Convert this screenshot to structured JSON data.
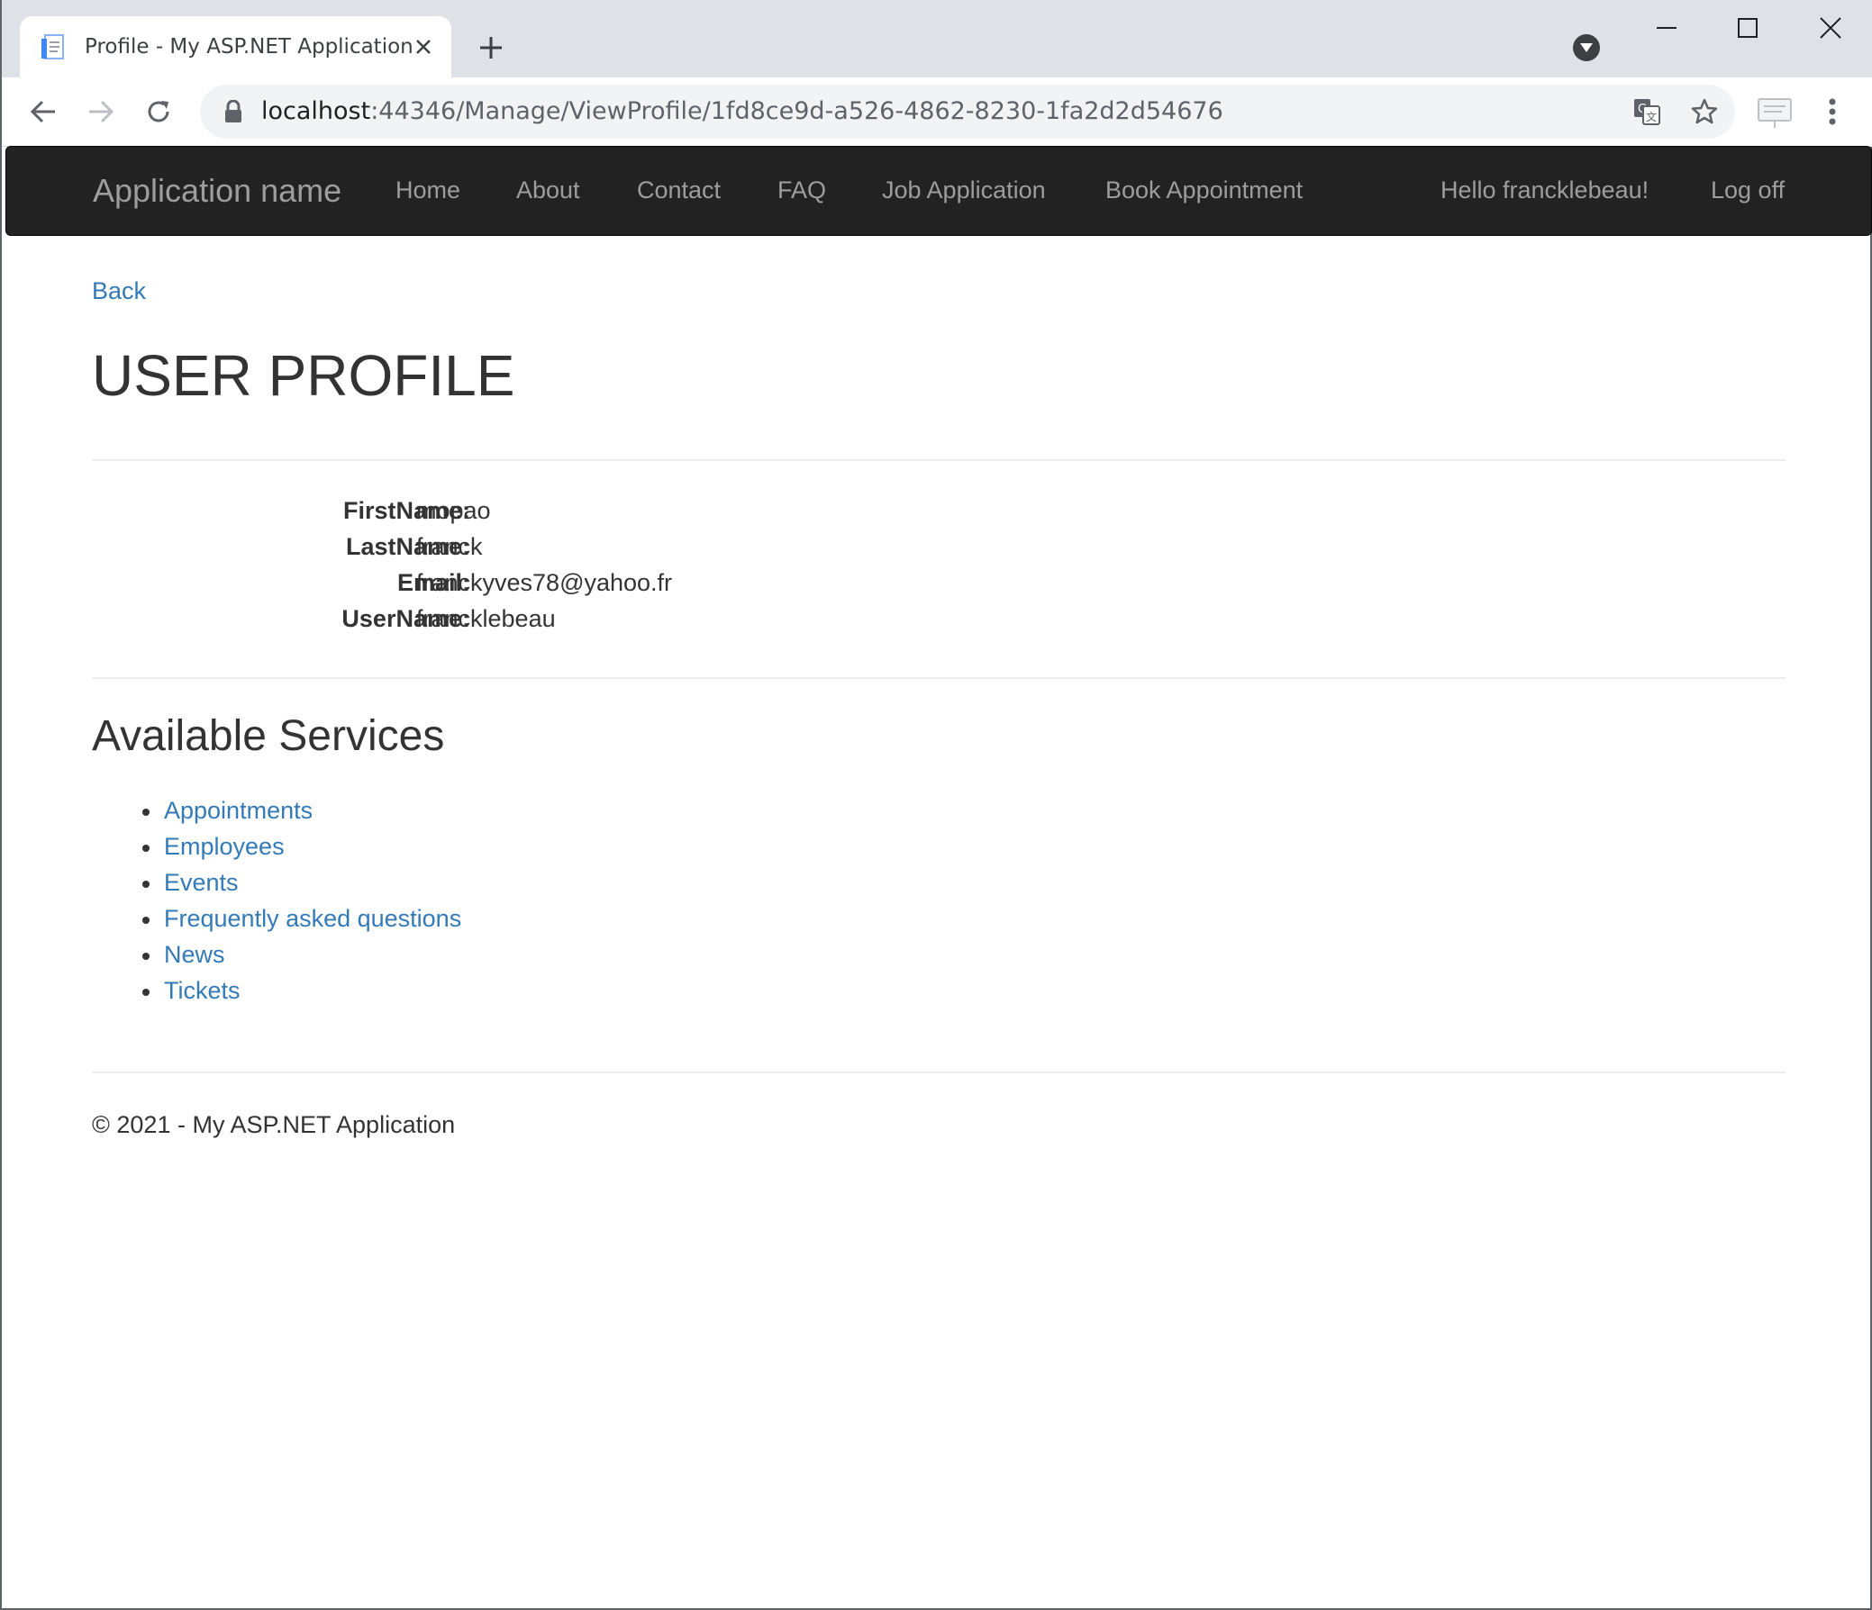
{
  "browser": {
    "tab_title": "Profile - My ASP.NET Application",
    "url_host": "localhost",
    "url_rest": ":44346/Manage/ViewProfile/1fd8ce9d-a526-4862-8230-1fa2d2d54676"
  },
  "navbar": {
    "brand": "Application name",
    "links": [
      "Home",
      "About",
      "Contact",
      "FAQ",
      "Job Application",
      "Book Appointment"
    ],
    "greeting": "Hello francklebeau!",
    "logoff": "Log off"
  },
  "page": {
    "back": "Back",
    "title": "USER PROFILE",
    "profile": [
      {
        "label": "FirstName:",
        "value": "mopao"
      },
      {
        "label": "LastName:",
        "value": "franck"
      },
      {
        "label": "Email:",
        "value": "franckyves78@yahoo.fr"
      },
      {
        "label": "UserName:",
        "value": "francklebeau"
      }
    ],
    "services_title": "Available Services",
    "services": [
      "Appointments",
      "Employees",
      "Events",
      "Frequently asked questions",
      "News",
      "Tickets"
    ]
  },
  "footer": {
    "text": "© 2021 - My ASP.NET Application"
  },
  "colors": {
    "link": "#337ab7",
    "navbar_bg": "#222222",
    "navbar_text": "#9d9d9d",
    "chrome_bg": "#dee1e6"
  }
}
